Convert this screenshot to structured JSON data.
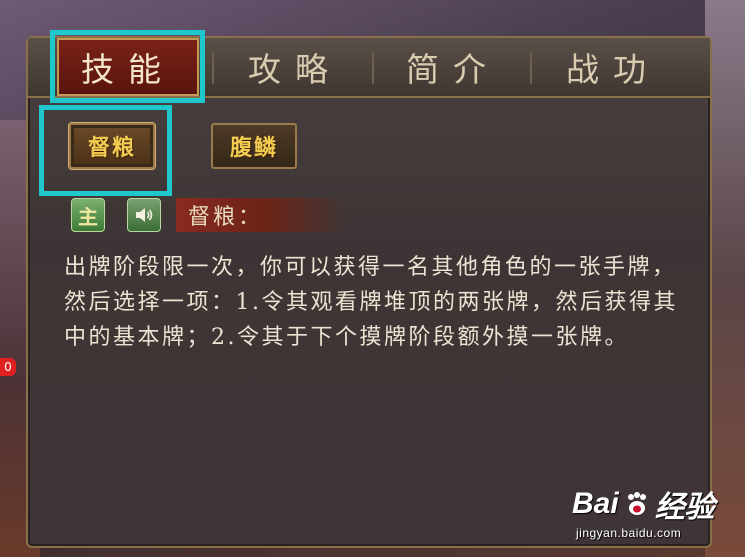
{
  "tabs": [
    {
      "label": "技能",
      "active": true
    },
    {
      "label": "攻略",
      "active": false
    },
    {
      "label": "简介",
      "active": false
    },
    {
      "label": "战功",
      "active": false
    }
  ],
  "skills": [
    {
      "label": "督粮",
      "active": true
    },
    {
      "label": "腹鳞",
      "active": false
    }
  ],
  "skill_detail": {
    "tag_label": "主",
    "sound_icon": "speaker-icon",
    "name": "督粮：",
    "description": "出牌阶段限一次，你可以获得一名其他角色的一张手牌，然后选择一项：1.令其观看牌堆顶的两张牌，然后获得其中的基本牌；2.令其于下个摸牌阶段额外摸一张牌。"
  },
  "side_badge": "0",
  "watermark": {
    "logo_left": "Bai",
    "logo_right": "经验",
    "url": "jingyan.baidu.com"
  },
  "colors": {
    "highlight": "#1ec8cc",
    "active_tab": "#7a2218",
    "skill_text": "#f2cc50"
  }
}
